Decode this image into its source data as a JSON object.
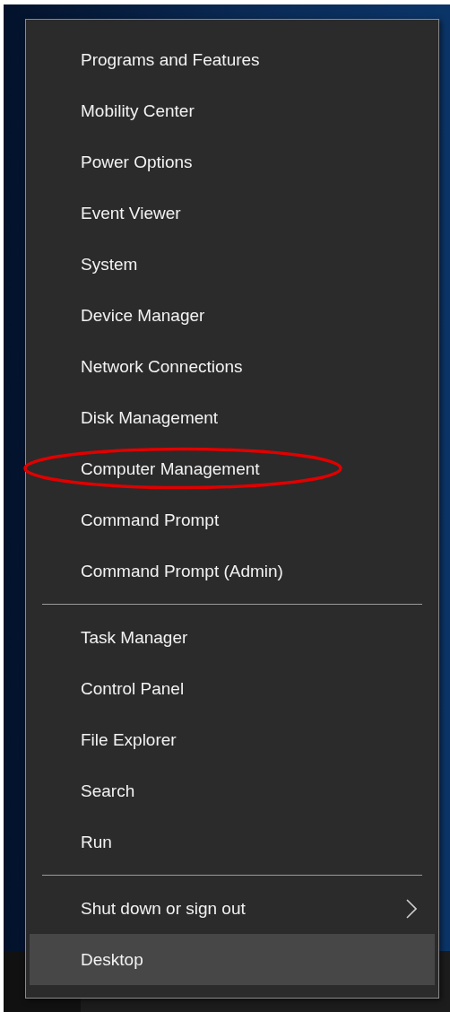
{
  "menu": {
    "groups": [
      {
        "items": [
          {
            "label": "Programs and Features",
            "highlighted": false,
            "circled": false,
            "has_submenu": false
          },
          {
            "label": "Mobility Center",
            "highlighted": false,
            "circled": false,
            "has_submenu": false
          },
          {
            "label": "Power Options",
            "highlighted": false,
            "circled": false,
            "has_submenu": false
          },
          {
            "label": "Event Viewer",
            "highlighted": false,
            "circled": false,
            "has_submenu": false
          },
          {
            "label": "System",
            "highlighted": false,
            "circled": false,
            "has_submenu": false
          },
          {
            "label": "Device Manager",
            "highlighted": false,
            "circled": false,
            "has_submenu": false
          },
          {
            "label": "Network Connections",
            "highlighted": false,
            "circled": false,
            "has_submenu": false
          },
          {
            "label": "Disk Management",
            "highlighted": false,
            "circled": false,
            "has_submenu": false
          },
          {
            "label": "Computer Management",
            "highlighted": false,
            "circled": true,
            "has_submenu": false
          },
          {
            "label": "Command Prompt",
            "highlighted": false,
            "circled": false,
            "has_submenu": false
          },
          {
            "label": "Command Prompt (Admin)",
            "highlighted": false,
            "circled": false,
            "has_submenu": false
          }
        ]
      },
      {
        "items": [
          {
            "label": "Task Manager",
            "highlighted": false,
            "circled": false,
            "has_submenu": false
          },
          {
            "label": "Control Panel",
            "highlighted": false,
            "circled": false,
            "has_submenu": false
          },
          {
            "label": "File Explorer",
            "highlighted": false,
            "circled": false,
            "has_submenu": false
          },
          {
            "label": "Search",
            "highlighted": false,
            "circled": false,
            "has_submenu": false
          },
          {
            "label": "Run",
            "highlighted": false,
            "circled": false,
            "has_submenu": false
          }
        ]
      },
      {
        "items": [
          {
            "label": "Shut down or sign out",
            "highlighted": false,
            "circled": false,
            "has_submenu": true
          },
          {
            "label": "Desktop",
            "highlighted": true,
            "circled": false,
            "has_submenu": false
          }
        ]
      }
    ]
  }
}
